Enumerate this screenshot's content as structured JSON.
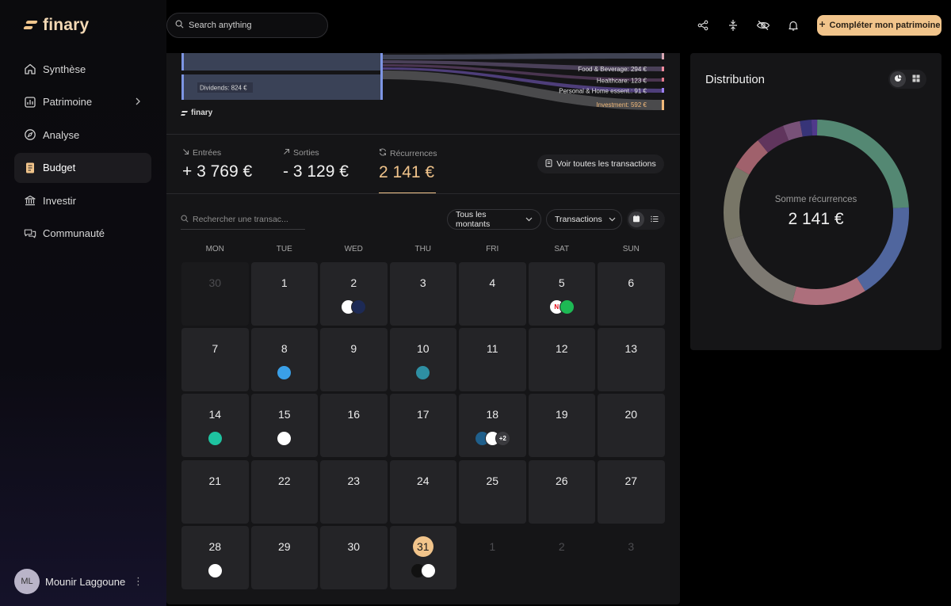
{
  "brand": {
    "name": "finary",
    "accent": "#f1c48b"
  },
  "search": {
    "placeholder": "Search anything"
  },
  "nav": [
    {
      "label": "Synthèse",
      "icon": "home-icon"
    },
    {
      "label": "Patrimoine",
      "icon": "chart-icon",
      "has_chevron": true
    },
    {
      "label": "Analyse",
      "icon": "compass-icon"
    },
    {
      "label": "Budget",
      "icon": "budget-icon",
      "active": true
    },
    {
      "label": "Investir",
      "icon": "bank-icon"
    },
    {
      "label": "Communauté",
      "icon": "chat-icon"
    }
  ],
  "user": {
    "initials": "ML",
    "name": "Mounir Laggoune",
    "more": "⋮"
  },
  "toolbar": {
    "cta_label": "Compléter mon patrimoine"
  },
  "sankey": {
    "left_label": "Dividends: 824 €",
    "right_labels": [
      {
        "text": "Food & Beverage: 294 €",
        "color": "#f28b9e"
      },
      {
        "text": "Healthcare: 123 €",
        "color": "#e67a8b"
      },
      {
        "text": "Personal & Home essent.: 91 €",
        "color": "#9b7ff0"
      },
      {
        "text": "Investment: 592 €",
        "color": "#f1b97a"
      }
    ],
    "footer_brand": "finary"
  },
  "stats": {
    "in_label": "Entrées",
    "in_value": "+ 3 769 €",
    "out_label": "Sorties",
    "out_value": "- 3 129 €",
    "rec_label": "Récurrences",
    "rec_value": "2 141 €"
  },
  "actions": {
    "view_all": "Voir toutes les transactions"
  },
  "filters": {
    "search_placeholder": "Rechercher une transac...",
    "amounts": "Tous les montants",
    "type": "Transactions"
  },
  "calendar": {
    "weekdays": [
      "MON",
      "TUE",
      "WED",
      "THU",
      "FRI",
      "SAT",
      "SUN"
    ],
    "days": [
      {
        "n": "30",
        "state": "muted"
      },
      {
        "n": "1"
      },
      {
        "n": "2",
        "logos": [
          {
            "c": "#ffffff",
            "t": ""
          },
          {
            "c": "#1d2a55",
            "t": ""
          }
        ]
      },
      {
        "n": "3"
      },
      {
        "n": "4"
      },
      {
        "n": "5",
        "logos": [
          {
            "c": "#ffffff",
            "t": "N",
            "tc": "#e50914"
          },
          {
            "c": "#1db954",
            "t": ""
          }
        ]
      },
      {
        "n": "6"
      },
      {
        "n": "7"
      },
      {
        "n": "8",
        "logos": [
          {
            "c": "#3aa0e8",
            "t": ""
          }
        ]
      },
      {
        "n": "9"
      },
      {
        "n": "10",
        "logos": [
          {
            "c": "#2e8fa3",
            "t": ""
          }
        ]
      },
      {
        "n": "11"
      },
      {
        "n": "12"
      },
      {
        "n": "13"
      },
      {
        "n": "14",
        "logos": [
          {
            "c": "#1ec3a0",
            "t": ""
          }
        ]
      },
      {
        "n": "15",
        "logos": [
          {
            "c": "#ffffff",
            "t": ""
          }
        ]
      },
      {
        "n": "16"
      },
      {
        "n": "17"
      },
      {
        "n": "18",
        "logos": [
          {
            "c": "#1f5f8b",
            "t": ""
          },
          {
            "c": "#ffffff",
            "t": ""
          },
          {
            "c": "#3a3a3e",
            "t": "+2"
          }
        ]
      },
      {
        "n": "19"
      },
      {
        "n": "20"
      },
      {
        "n": "21"
      },
      {
        "n": "22"
      },
      {
        "n": "23"
      },
      {
        "n": "24"
      },
      {
        "n": "25"
      },
      {
        "n": "26"
      },
      {
        "n": "27"
      },
      {
        "n": "28",
        "logos": [
          {
            "c": "#ffffff",
            "t": ""
          }
        ]
      },
      {
        "n": "29"
      },
      {
        "n": "30"
      },
      {
        "n": "31",
        "today": true,
        "logos": [
          {
            "c": "#111111",
            "t": ""
          },
          {
            "c": "#ffffff",
            "t": ""
          }
        ]
      },
      {
        "n": "1",
        "state": "outside"
      },
      {
        "n": "2",
        "state": "outside"
      },
      {
        "n": "3",
        "state": "outside"
      }
    ]
  },
  "distribution": {
    "title": "Distribution",
    "center_label": "Somme récurrences",
    "center_value": "2 141 €",
    "segments": [
      {
        "value": 24,
        "color": "#5f9c84"
      },
      {
        "value": 17,
        "color": "#5a74b6"
      },
      {
        "value": 13,
        "color": "#c87f8e"
      },
      {
        "value": 16,
        "color": "#8f8b82"
      },
      {
        "value": 13,
        "color": "#8a8775"
      },
      {
        "value": 6,
        "color": "#b96f7b"
      },
      {
        "value": 5,
        "color": "#6d3b6a"
      },
      {
        "value": 3,
        "color": "#8a5c8a"
      },
      {
        "value": 2,
        "color": "#3d3a8a"
      },
      {
        "value": 1,
        "color": "#5b3fa0"
      }
    ]
  }
}
